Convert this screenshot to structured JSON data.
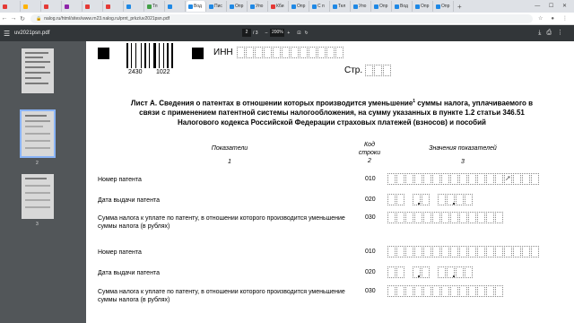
{
  "browser": {
    "tabs": [
      {
        "label": "",
        "color": "#e53935"
      },
      {
        "label": "",
        "color": "#ffb300"
      },
      {
        "label": "",
        "color": "#e53935"
      },
      {
        "label": "",
        "color": "#8e24aa"
      },
      {
        "label": "",
        "color": "#e53935"
      },
      {
        "label": "",
        "color": "#e53935"
      },
      {
        "label": "",
        "color": "#1e88e5"
      },
      {
        "label": "Тп",
        "color": "#43a047"
      },
      {
        "label": "",
        "color": "#1e88e5"
      },
      {
        "label": "Вод",
        "color": "#1e88e5"
      },
      {
        "label": "Пис",
        "color": "#1e88e5"
      },
      {
        "label": "Опр",
        "color": "#1e88e5"
      },
      {
        "label": "Упо",
        "color": "#1e88e5"
      },
      {
        "label": "Кби",
        "color": "#e53935"
      },
      {
        "label": "Опр",
        "color": "#1e88e5"
      },
      {
        "label": "С п",
        "color": "#1e88e5"
      },
      {
        "label": "Тел",
        "color": "#1e88e5"
      },
      {
        "label": "Упо",
        "color": "#1e88e5"
      },
      {
        "label": "Опр",
        "color": "#1e88e5"
      },
      {
        "label": "Вод",
        "color": "#1e88e5"
      },
      {
        "label": "Опр",
        "color": "#1e88e5"
      },
      {
        "label": "Опр",
        "color": "#1e88e5"
      }
    ],
    "active_tab_index": 9,
    "url": "nalog.ru/html/sites/www.rn23.nalog.ru/prnt_prkz/uv2021psn.pdf",
    "window_controls": "— ☐ ✕"
  },
  "pdf": {
    "filename": "uv2021psn.pdf",
    "current_page": "2",
    "total_pages": "/ 3",
    "zoom": "200%",
    "thumb_labels": [
      "",
      "2",
      "3"
    ]
  },
  "form": {
    "barcode_left": "2430",
    "barcode_right": "1022",
    "inn_label": "ИНН",
    "page_label": "Стр.",
    "title_part1": "Лист А. Сведения о патентах в отношении которых производится уменьшение",
    "title_sup": "1",
    "title_part2": " суммы налога, уплачиваемого в связи с применением патентной системы налогообложения, на сумму указанных в пункте 1.2 статьи 346.51 Налогового кодекса Российской Федерации страховых платежей (взносов) и пособий",
    "col1_header": "Показатели",
    "col1_num": "1",
    "col2_header_line1": "Код",
    "col2_header_line2": "строки",
    "col2_num": "2",
    "col3_header": "Значения показателей",
    "col3_num": "3",
    "rows": [
      {
        "label": "Номер патента",
        "code": "010"
      },
      {
        "label": "Дата выдачи патента",
        "code": "020"
      },
      {
        "label": "Сумма налога к уплате по патенту, в отношении которого производится уменьшение суммы налога (в рублях)",
        "code": "030"
      },
      {
        "label": "Номер патента",
        "code": "010"
      },
      {
        "label": "Дата выдачи патента",
        "code": "020"
      },
      {
        "label": "Сумма налога к уплате по патенту, в отношении которого производится уменьшение суммы налога (в рублях)",
        "code": "030"
      }
    ]
  },
  "icons": {
    "menu": "hamburger-icon",
    "download": "download-icon",
    "print": "print-icon",
    "more": "more-vert-icon"
  }
}
